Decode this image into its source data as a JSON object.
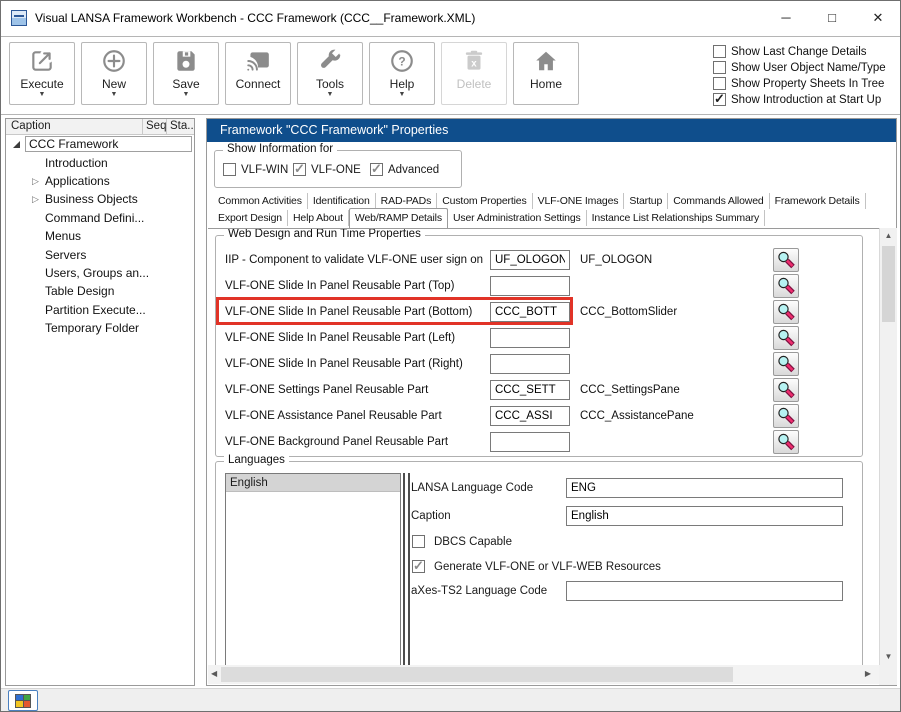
{
  "window": {
    "title": "Visual LANSA Framework Workbench - CCC Framework (CCC__Framework.XML)",
    "controls": {
      "minimize": "─",
      "maximize": "□",
      "close": "✕"
    }
  },
  "icons": {
    "dropdown": "▼",
    "check": "✓",
    "collapsed": "▷",
    "up": "▲",
    "down": "▼",
    "left": "◀",
    "right": "▶"
  },
  "toolbar": {
    "buttons": [
      {
        "label": "Execute",
        "dropdown": true,
        "disabled": false
      },
      {
        "label": "New",
        "dropdown": true,
        "disabled": false
      },
      {
        "label": "Save",
        "dropdown": true,
        "disabled": false
      },
      {
        "label": "Connect",
        "dropdown": false,
        "disabled": false
      },
      {
        "label": "Tools",
        "dropdown": true,
        "disabled": false
      },
      {
        "label": "Help",
        "dropdown": true,
        "disabled": false
      },
      {
        "label": "Delete",
        "dropdown": false,
        "disabled": true
      },
      {
        "label": "Home",
        "dropdown": false,
        "disabled": false
      }
    ],
    "options": [
      {
        "label": "Show Last Change Details",
        "checked": false
      },
      {
        "label": "Show User Object Name/Type",
        "checked": false
      },
      {
        "label": "Show Property Sheets In Tree",
        "checked": false
      },
      {
        "label": "Show Introduction at Start Up",
        "checked": true
      }
    ]
  },
  "tree": {
    "columns": {
      "caption": "Caption",
      "seq": "Seq",
      "sta": "Sta.."
    },
    "items": [
      {
        "label": "CCC Framework",
        "expander": "expanded",
        "selected": true
      },
      {
        "label": "Introduction",
        "expander": "none"
      },
      {
        "label": "Applications",
        "expander": "collapsed"
      },
      {
        "label": "Business Objects",
        "expander": "collapsed"
      },
      {
        "label": "Command Defini...",
        "expander": "none"
      },
      {
        "label": "Menus",
        "expander": "none"
      },
      {
        "label": "Servers",
        "expander": "none"
      },
      {
        "label": "Users, Groups an...",
        "expander": "none"
      },
      {
        "label": "Table Design",
        "expander": "none"
      },
      {
        "label": "Partition Execute...",
        "expander": "none"
      },
      {
        "label": "Temporary Folder",
        "expander": "none"
      }
    ]
  },
  "main": {
    "header": "Framework \"CCC Framework\" Properties",
    "show_info": {
      "legend": "Show Information for",
      "checks": [
        {
          "label": "VLF-WIN",
          "checked": false
        },
        {
          "label": "VLF-ONE",
          "checked": true
        },
        {
          "label": "Advanced",
          "checked": true
        }
      ]
    },
    "tabs_row1": [
      "Common Activities",
      "Identification",
      "RAD-PADs",
      "Custom Properties",
      "VLF-ONE Images",
      "Startup",
      "Commands Allowed",
      "Framework Details"
    ],
    "tabs_row2": [
      "Export Design",
      "Help About",
      "Web/RAMP Details",
      "User Administration Settings",
      "Instance List Relationships Summary"
    ],
    "active_tab": "Web/RAMP Details",
    "web_group": {
      "legend": "Web Design and Run Time Properties",
      "rows": [
        {
          "label": "IIP - Component to validate VLF-ONE user sign on",
          "value": "UF_OLOGON",
          "resolved": "UF_OLOGON",
          "highlighted": false
        },
        {
          "label": "VLF-ONE Slide In Panel Reusable Part (Top)",
          "value": "",
          "resolved": "",
          "highlighted": false
        },
        {
          "label": "VLF-ONE Slide In Panel Reusable Part (Bottom)",
          "value": "CCC_BOTT",
          "resolved": "CCC_BottomSlider",
          "highlighted": true
        },
        {
          "label": "VLF-ONE Slide In Panel Reusable Part (Left)",
          "value": "",
          "resolved": "",
          "highlighted": false
        },
        {
          "label": "VLF-ONE Slide In Panel Reusable Part (Right)",
          "value": "",
          "resolved": "",
          "highlighted": false
        },
        {
          "label": "VLF-ONE Settings Panel Reusable Part",
          "value": "CCC_SETT",
          "resolved": "CCC_SettingsPane",
          "highlighted": false
        },
        {
          "label": "VLF-ONE Assistance Panel Reusable Part",
          "value": "CCC_ASSI",
          "resolved": "CCC_AssistancePane",
          "highlighted": false
        },
        {
          "label": "VLF-ONE Background Panel Reusable Part",
          "value": "",
          "resolved": "",
          "highlighted": false
        }
      ]
    },
    "languages": {
      "legend": "Languages",
      "list": [
        {
          "label": "English",
          "selected": true
        }
      ],
      "fields": [
        {
          "label": "LANSA Language Code",
          "value": "ENG"
        },
        {
          "label": "Caption",
          "value": "English"
        },
        {
          "label": "aXes-TS2 Language Code",
          "value": ""
        }
      ],
      "checks": [
        {
          "label": "DBCS Capable",
          "checked": false
        },
        {
          "label": "Generate VLF-ONE or VLF-WEB Resources",
          "checked": true
        }
      ]
    }
  },
  "colors": {
    "header_bg": "#0F4E8C",
    "highlight_red": "#E13327",
    "status_icon": [
      "#2F6FD0",
      "#3FA544",
      "#F2C521",
      "#E4572E"
    ]
  }
}
